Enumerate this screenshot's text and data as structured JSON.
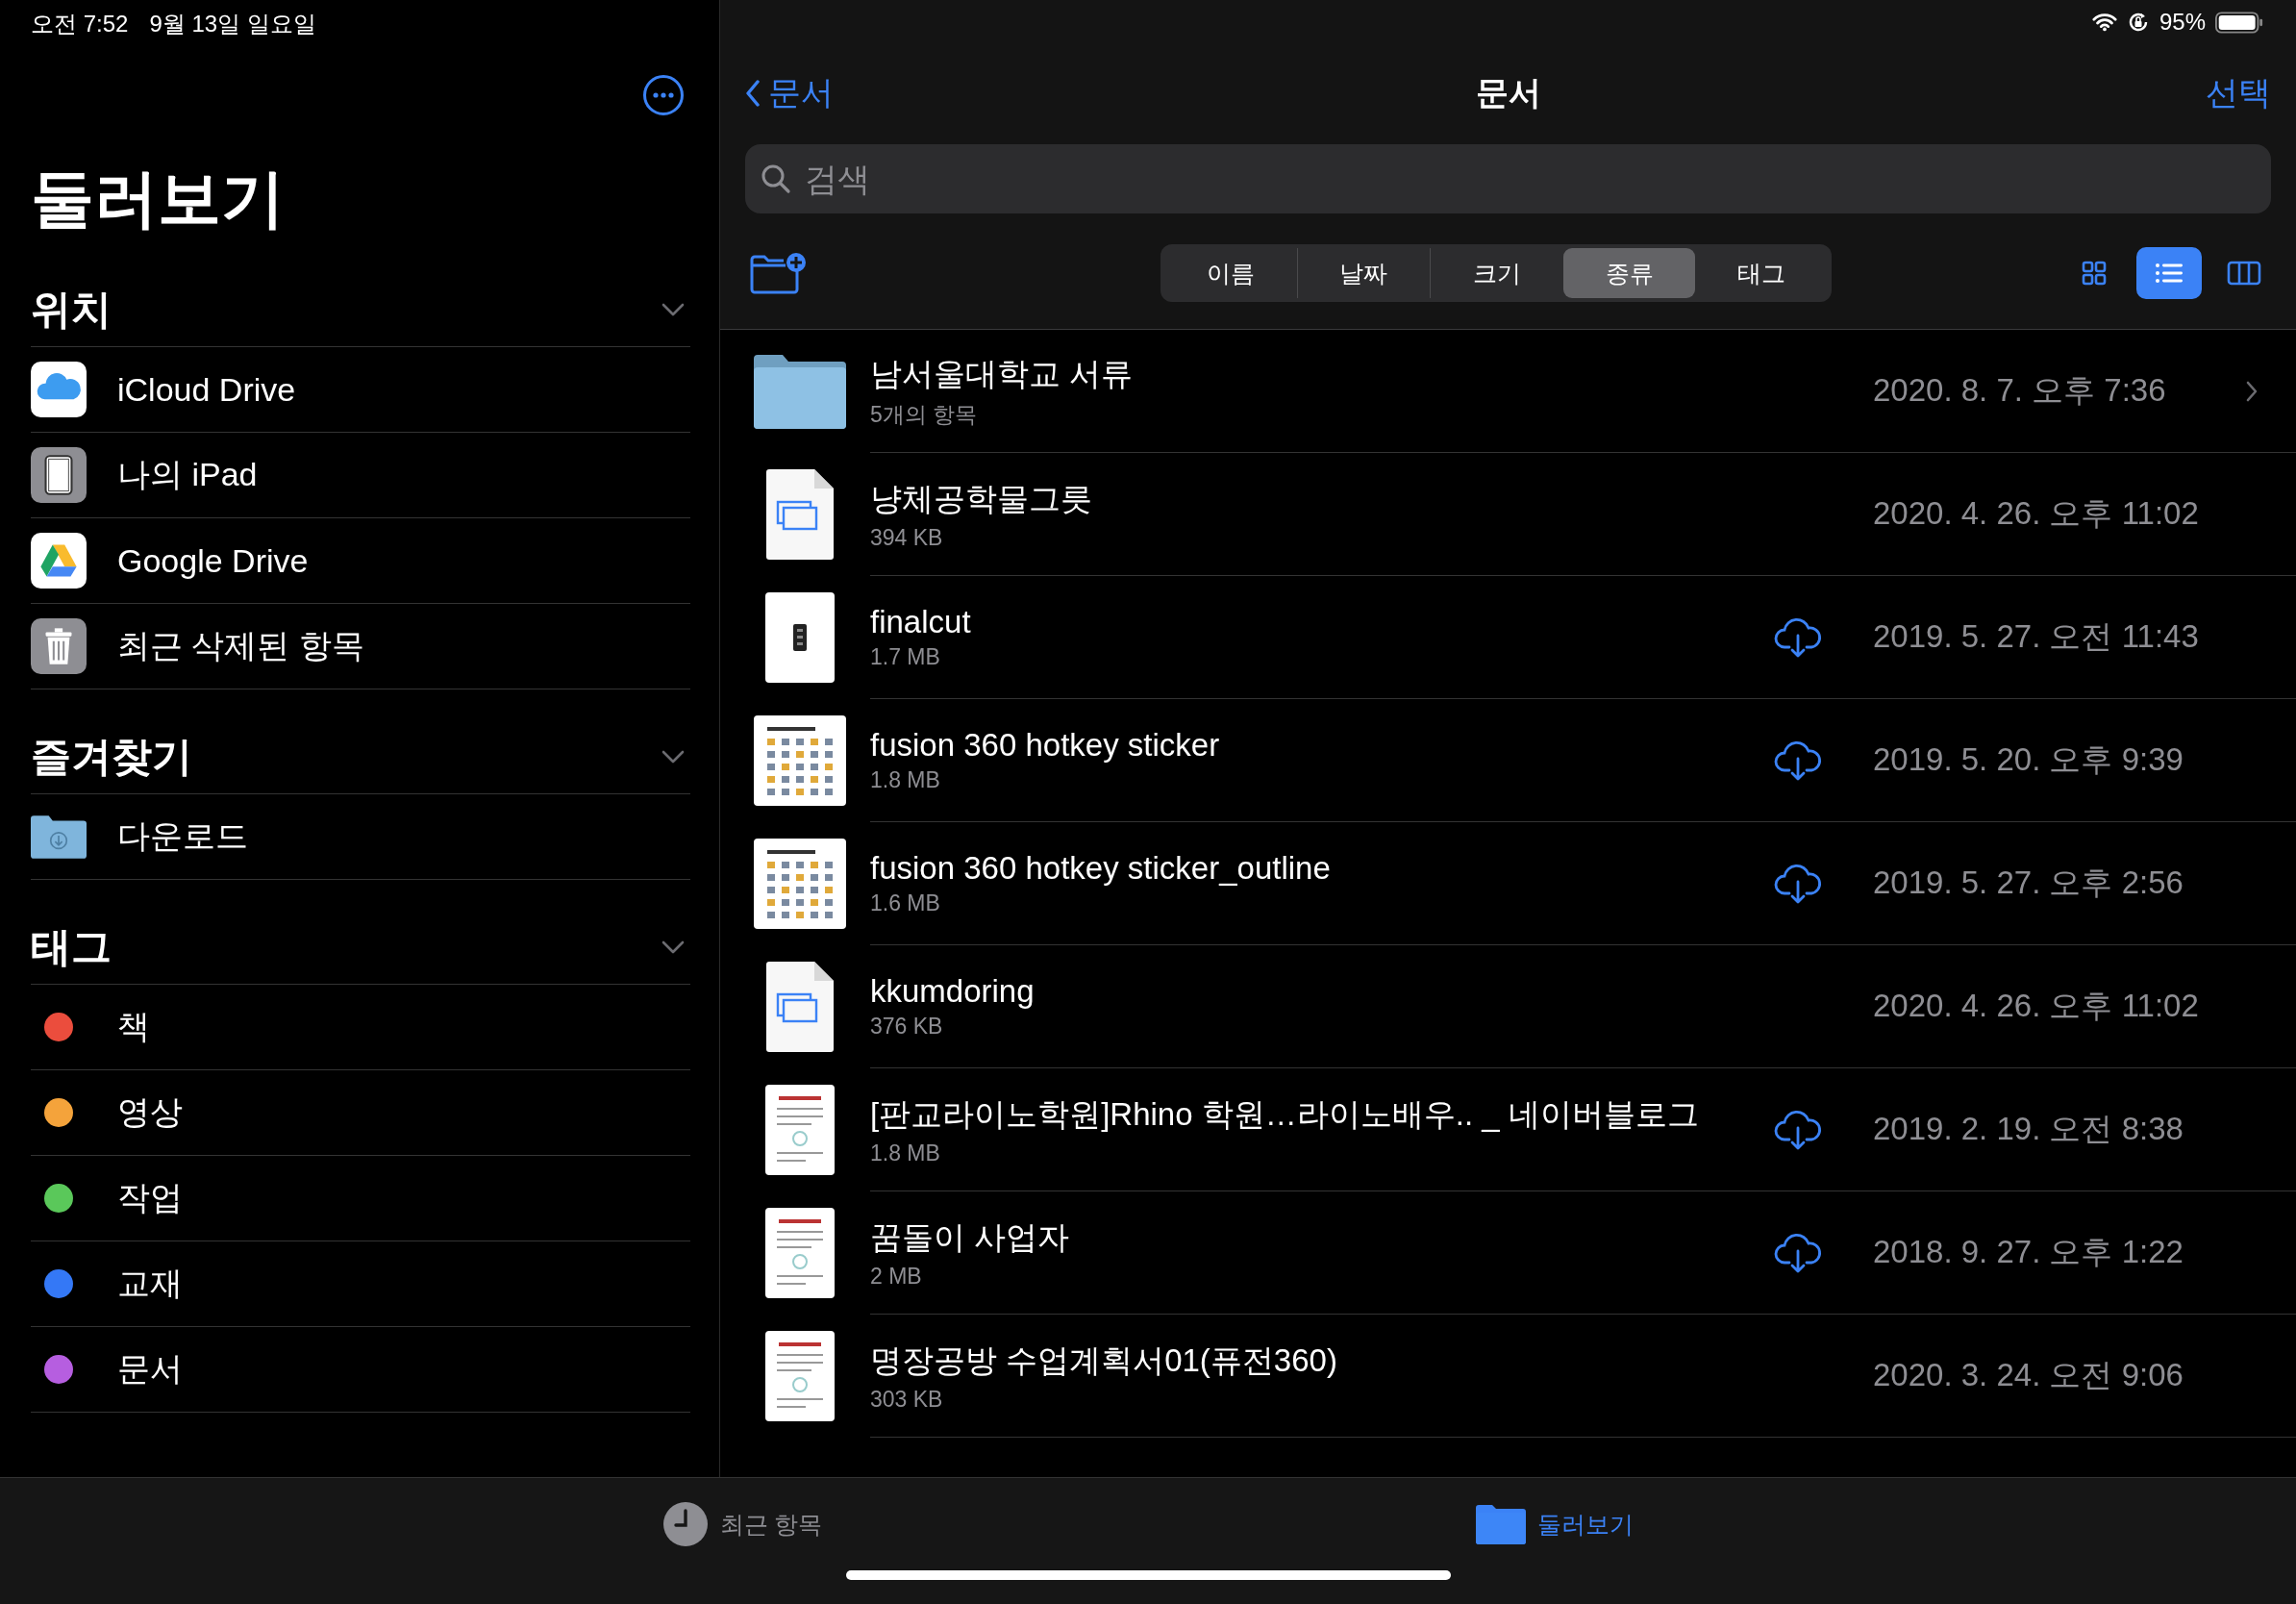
{
  "status_bar": {
    "time": "오전 7:52",
    "date": "9월 13일 일요일",
    "battery": "95%"
  },
  "sidebar": {
    "title": "둘러보기",
    "sections": [
      {
        "title": "위치",
        "expanded": true,
        "items": [
          {
            "label": "iCloud Drive",
            "kind": "icloud"
          },
          {
            "label": "나의 iPad",
            "kind": "ipad"
          },
          {
            "label": "Google Drive",
            "kind": "gdrive"
          },
          {
            "label": "최근 삭제된 항목",
            "kind": "trash"
          }
        ]
      },
      {
        "title": "즐겨찾기",
        "expanded": true,
        "items": [
          {
            "label": "다운로드",
            "kind": "downloads"
          }
        ]
      },
      {
        "title": "태그",
        "expanded": true,
        "items": [
          {
            "label": "책",
            "kind": "tag",
            "color": "#eb4d3d"
          },
          {
            "label": "영상",
            "kind": "tag",
            "color": "#f4a33b"
          },
          {
            "label": "작업",
            "kind": "tag",
            "color": "#5ac85a"
          },
          {
            "label": "교재",
            "kind": "tag",
            "color": "#3478f6"
          },
          {
            "label": "문서",
            "kind": "tag",
            "color": "#b65ee0"
          }
        ]
      }
    ]
  },
  "main": {
    "back_label": "문서",
    "title": "문서",
    "action": "선택",
    "search": {
      "placeholder": "검색"
    },
    "sort_options": [
      {
        "label": "이름",
        "selected": false
      },
      {
        "label": "날짜",
        "selected": false
      },
      {
        "label": "크기",
        "selected": false
      },
      {
        "label": "종류",
        "selected": true
      },
      {
        "label": "태그",
        "selected": false
      }
    ],
    "view_modes": [
      {
        "kind": "grid",
        "selected": false
      },
      {
        "kind": "list",
        "selected": true
      },
      {
        "kind": "columns",
        "selected": false
      }
    ],
    "files": [
      {
        "name": "남서울대학교 서류",
        "detail": "5개의 항목",
        "date": "2020. 8. 7. 오후 7:36",
        "kind": "folder",
        "in_cloud": false
      },
      {
        "name": "냥체공학물그릇",
        "detail": "394 KB",
        "date": "2020. 4. 26. 오후 11:02",
        "kind": "document",
        "in_cloud": false
      },
      {
        "name": "finalcut",
        "detail": "1.7 MB",
        "date": "2019. 5. 27. 오전 11:43",
        "kind": "phone",
        "in_cloud": true
      },
      {
        "name": "fusion 360 hotkey sticker",
        "detail": "1.8 MB",
        "date": "2019. 5. 20. 오후 9:39",
        "kind": "sheet",
        "in_cloud": true
      },
      {
        "name": "fusion 360 hotkey sticker_outline",
        "detail": "1.6 MB",
        "date": "2019. 5. 27. 오후 2:56",
        "kind": "sheet",
        "in_cloud": true
      },
      {
        "name": "kkumdoring",
        "detail": "376 KB",
        "date": "2020. 4. 26. 오후 11:02",
        "kind": "document",
        "in_cloud": false
      },
      {
        "name": "[판교라이노학원]Rhino 학원…라이노배우.. _ 네이버블로그",
        "detail": "1.8 MB",
        "date": "2019. 2. 19. 오전 8:38",
        "kind": "page",
        "in_cloud": true
      },
      {
        "name": "꿈돌이 사업자",
        "detail": "2 MB",
        "date": "2018. 9. 27. 오후 1:22",
        "kind": "page",
        "in_cloud": true
      },
      {
        "name": "명장공방 수업계획서01(퓨전360)",
        "detail": "303 KB",
        "date": "2020. 3. 24. 오전 9:06",
        "kind": "page",
        "in_cloud": false
      }
    ]
  },
  "tab_bar": [
    {
      "label": "최근 항목",
      "kind": "recents",
      "selected": false
    },
    {
      "label": "둘러보기",
      "kind": "browse",
      "selected": true
    }
  ]
}
